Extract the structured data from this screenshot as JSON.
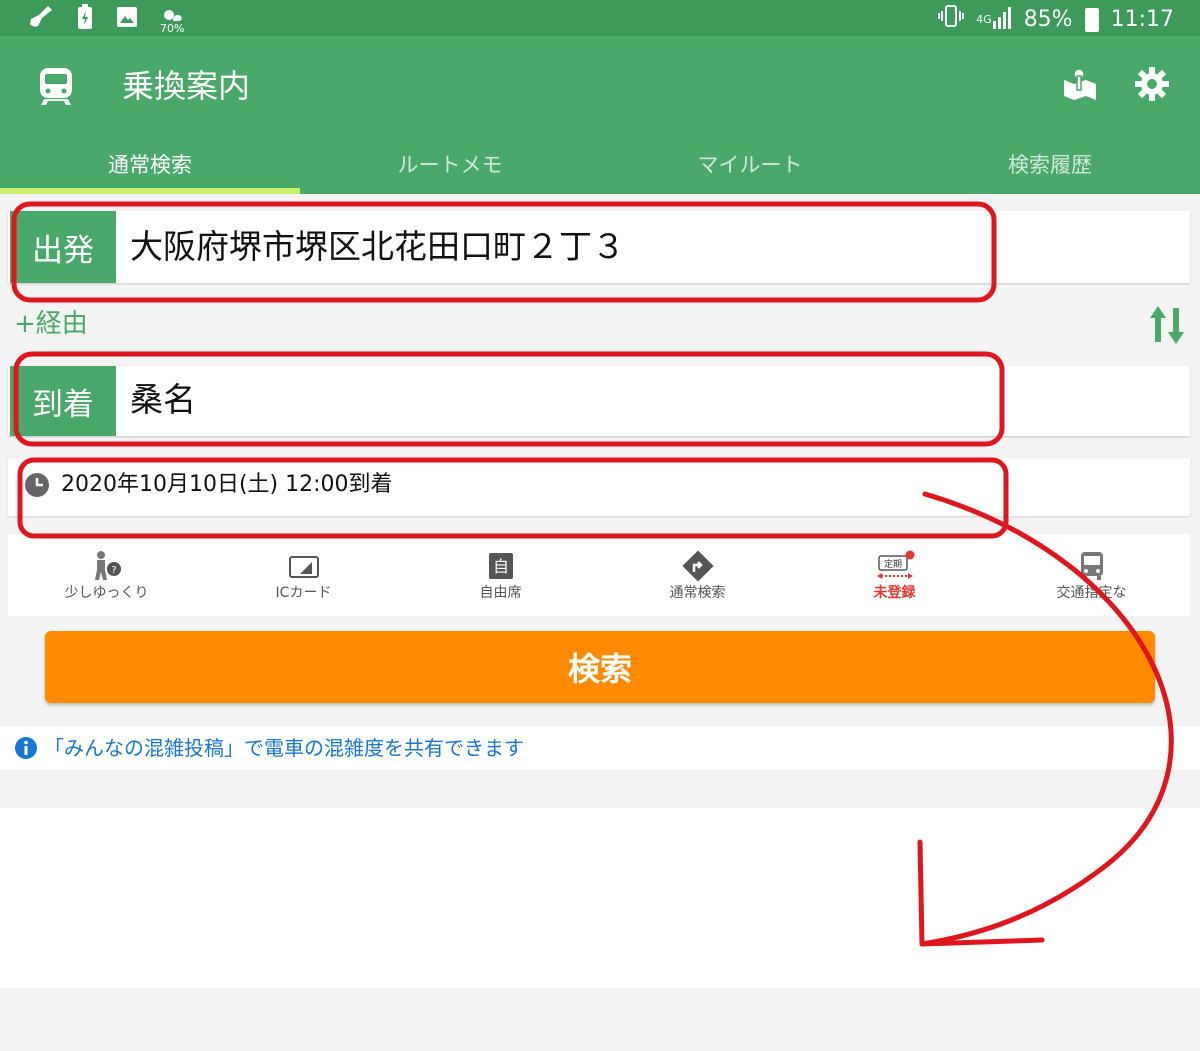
{
  "status_bar": {
    "left_icons": [
      "broom-icon",
      "battery-saver-icon",
      "image-icon",
      "weather-icon"
    ],
    "weather_percent": "70%",
    "network": "4G",
    "battery": "85%",
    "time": "11:17"
  },
  "app_bar": {
    "title": "乗換案内",
    "icons": [
      "train-icon",
      "map-pin-icon",
      "gear-icon"
    ]
  },
  "tabs": [
    {
      "label": "通常検索",
      "active": true
    },
    {
      "label": "ルートメモ",
      "active": false
    },
    {
      "label": "マイルート",
      "active": false
    },
    {
      "label": "検索履歴",
      "active": false
    }
  ],
  "departure": {
    "label": "出発",
    "value": "大阪府堺市堺区北花田口町２丁３"
  },
  "via": {
    "label": "+経由"
  },
  "arrival": {
    "label": "到着",
    "value": "桑名"
  },
  "datetime": {
    "value": "2020年10月10日(土)  12:00到着"
  },
  "options": [
    {
      "label": "少しゆっくり",
      "icon": "walker-icon"
    },
    {
      "label": "ICカード",
      "icon": "ic-card-icon"
    },
    {
      "label": "自由席",
      "icon": "seat-icon"
    },
    {
      "label": "通常検索",
      "icon": "route-sign-icon"
    },
    {
      "label": "未登録",
      "icon": "commuter-pass-icon",
      "badge": "定期"
    },
    {
      "label": "交通指定な",
      "icon": "bus-icon"
    }
  ],
  "search_button": {
    "label": "検索"
  },
  "info": {
    "text": "「みんなの混雑投稿」で電車の混雑度を共有できます"
  },
  "colors": {
    "status_bar": "#3d9a5a",
    "primary": "#4aa96a",
    "tab_indicator": "#c9ef6c",
    "search_button": "#ff8a00",
    "info_text": "#1976d2",
    "annotation": "#e0161e",
    "unregistered": "#e53935"
  }
}
